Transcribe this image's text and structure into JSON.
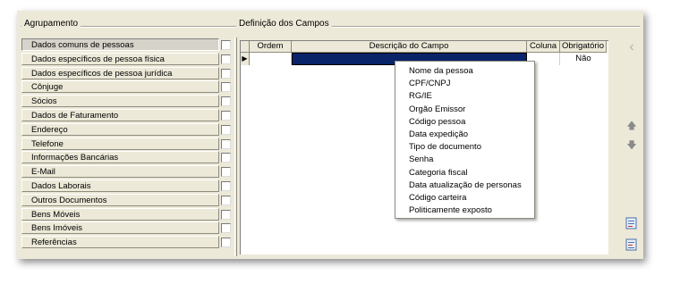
{
  "groups": {
    "agrupamento_label": "Agrupamento",
    "definicao_label": "Definição dos Campos"
  },
  "sidebar": {
    "items": [
      {
        "label": "Dados comuns de pessoas",
        "selected": true
      },
      {
        "label": "Dados específicos de pessoa física"
      },
      {
        "label": "Dados específicos de pessoa jurídica"
      },
      {
        "label": "Cônjuge"
      },
      {
        "label": "Sócios"
      },
      {
        "label": "Dados de Faturamento"
      },
      {
        "label": "Endereço"
      },
      {
        "label": "Telefone"
      },
      {
        "label": "Informações Bancárias"
      },
      {
        "label": "E-Mail"
      },
      {
        "label": "Dados Laborais"
      },
      {
        "label": "Outros Documentos"
      },
      {
        "label": "Bens Móveis"
      },
      {
        "label": "Bens Imóveis"
      },
      {
        "label": "Referências"
      }
    ]
  },
  "grid": {
    "columns": [
      "Ordem",
      "Descrição do Campo",
      "Coluna",
      "Obrigatório"
    ],
    "row": {
      "indicator": "▶",
      "ordem": "",
      "descricao": "",
      "coluna": "",
      "obrigatorio": "Não"
    }
  },
  "dropdown": {
    "options": [
      "Nome da pessoa",
      "CPF/CNPJ",
      "RG/IE",
      "Orgão Emissor",
      "Código pessoa",
      "Data expedição",
      "Tipo de documento",
      "Senha",
      "Categoria fiscal",
      "Data atualização de personas",
      "Código carteira",
      "Politicamente exposto"
    ]
  },
  "toolbar": {
    "icons": [
      "chevron-left-icon",
      "arrow-up-icon",
      "arrow-down-icon",
      "import-icon",
      "export-icon"
    ],
    "up_glyph": "🡅",
    "down_glyph": "🡇",
    "left_glyph": "‹"
  },
  "colors": {
    "selection": "#0a246a",
    "window": "#ece9d8"
  }
}
